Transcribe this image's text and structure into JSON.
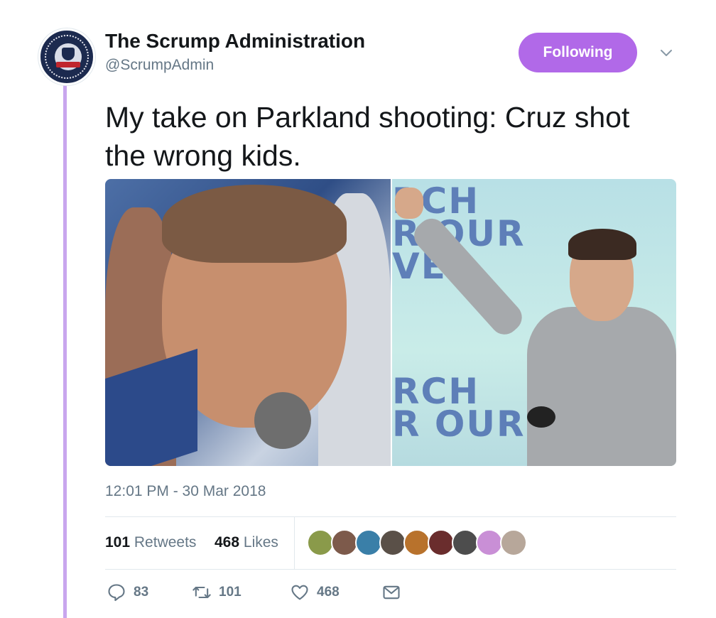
{
  "tweet": {
    "display_name": "The Scrump Administration",
    "handle": "@ScrumpAdmin",
    "follow_button_label": "Following",
    "text": "My take on Parkland shooting: Cruz shot the wrong kids.",
    "timestamp": "12:01 PM - 30 Mar 2018"
  },
  "media": {
    "right_photo_banner_top": "RCH\nR OUR\nVES",
    "right_photo_banner_bottom": "RCH\nR OUR"
  },
  "stats": {
    "retweets_count": "101",
    "retweets_label": "Retweets",
    "likes_count": "468",
    "likes_label": "Likes"
  },
  "likers": [
    {
      "color": "#8a9a4a"
    },
    {
      "color": "#7d5a4b"
    },
    {
      "color": "#3a7fa8"
    },
    {
      "color": "#5a5048"
    },
    {
      "color": "#b8722c"
    },
    {
      "color": "#6a2d2d"
    },
    {
      "color": "#4d4d4d"
    },
    {
      "color": "#c98fd6"
    },
    {
      "color": "#b7a79a"
    }
  ],
  "actions": {
    "reply_count": "83",
    "retweet_count": "101",
    "like_count": "468"
  },
  "colors": {
    "accent": "#b169e8",
    "thread_line": "#c9a6ee",
    "secondary_text": "#657786"
  },
  "icons": [
    "chevron-down-icon",
    "reply-icon",
    "retweet-icon",
    "heart-icon",
    "envelope-icon"
  ]
}
